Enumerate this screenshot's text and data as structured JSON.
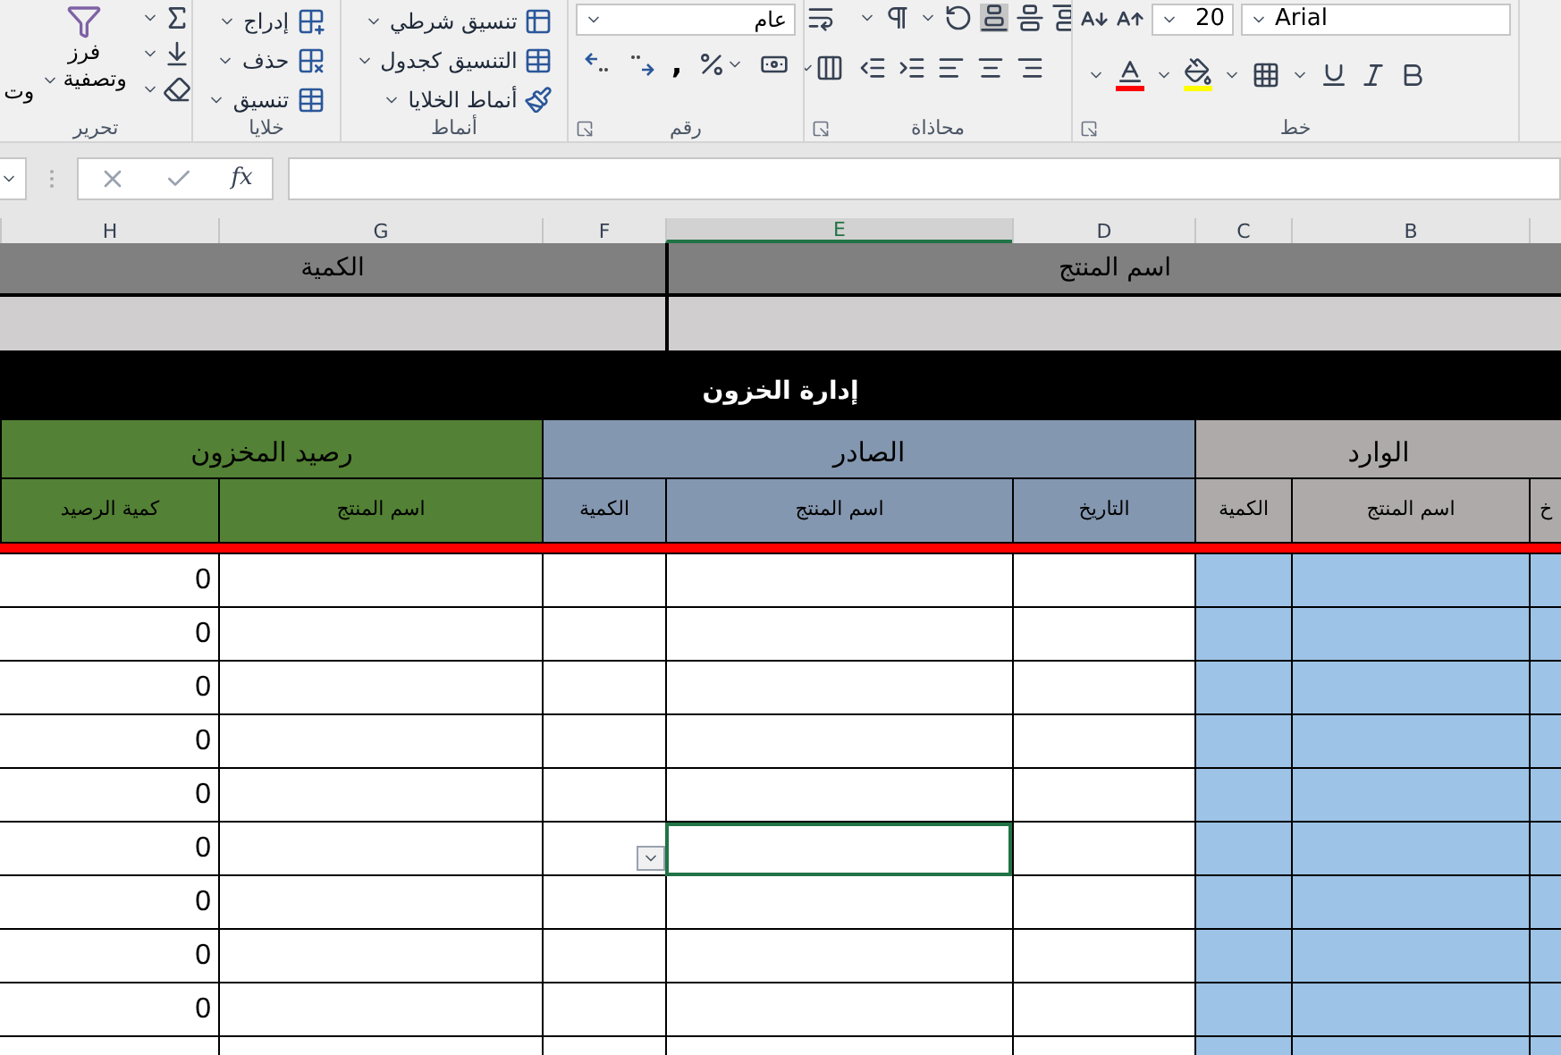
{
  "ribbon": {
    "editing": {
      "label": "تحرير",
      "cut_text": "وت",
      "sort_line1": "فرز",
      "sort_line2": "وتصفية"
    },
    "cells": {
      "label": "خلايا",
      "commands": [
        "إدراج",
        "حذف",
        "تنسيق"
      ]
    },
    "styles": {
      "label": "أنماط",
      "commands": [
        "تنسيق شرطي",
        "التنسيق كجدول",
        "أنماط الخلايا"
      ]
    },
    "number": {
      "label": "رقم",
      "format": "عام",
      "comma": ","
    },
    "alignment": {
      "label": "محاذاة"
    },
    "font": {
      "label": "خط",
      "size": "20",
      "name": "Arial"
    }
  },
  "formula_bar": {
    "fx": "fx"
  },
  "column_headers": [
    {
      "label": "B",
      "selected": false
    },
    {
      "label": "C",
      "selected": false
    },
    {
      "label": "D",
      "selected": false
    },
    {
      "label": "E",
      "selected": true
    },
    {
      "label": "F",
      "selected": false
    },
    {
      "label": "G",
      "selected": false
    },
    {
      "label": "H",
      "selected": false
    }
  ],
  "top_row": [
    "اسم المنتج",
    "الكمية"
  ],
  "title": "إدارة الخزون",
  "sections": [
    {
      "label": "الوارد",
      "color": "#aeaaaa"
    },
    {
      "label": "الصادر",
      "color": "#8497b0"
    },
    {
      "label": "رصيد المخزون",
      "color": "#538135"
    }
  ],
  "subheaders": [
    "خ",
    "اسم المنتج",
    "الكمية",
    "التاريخ",
    "اسم المنتج",
    "الكمية",
    "اسم المنتج",
    "كمية الرصيد"
  ],
  "rows": [
    {
      "balance": "0",
      "selected": false
    },
    {
      "balance": "0",
      "selected": false
    },
    {
      "balance": "0",
      "selected": false
    },
    {
      "balance": "0",
      "selected": false
    },
    {
      "balance": "0",
      "selected": false
    },
    {
      "balance": "0",
      "selected": true
    },
    {
      "balance": "0",
      "selected": false
    },
    {
      "balance": "0",
      "selected": false
    },
    {
      "balance": "0",
      "selected": false
    }
  ]
}
